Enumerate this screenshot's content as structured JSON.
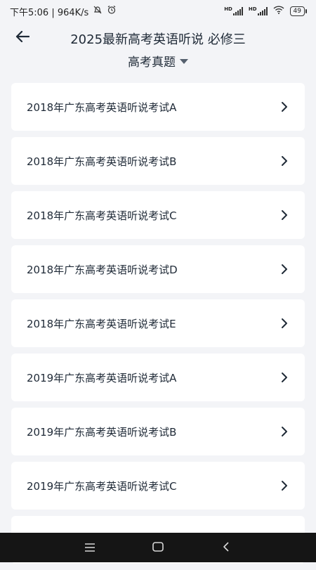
{
  "status_bar": {
    "time_speed": "下午5:06 | 964K/s",
    "hd1": "HD",
    "hd2": "HD",
    "battery": "49"
  },
  "header": {
    "title": "2025最新高考英语听说 必修三",
    "filter_label": "高考真题",
    "back_icon": "arrow-left-icon"
  },
  "list": {
    "items": [
      "2018年广东高考英语听说考试A",
      "2018年广东高考英语听说考试B",
      "2018年广东高考英语听说考试C",
      "2018年广东高考英语听说考试D",
      "2018年广东高考英语听说考试E",
      "2019年广东高考英语听说考试A",
      "2019年广东高考英语听说考试B",
      "2019年广东高考英语听说考试C",
      ""
    ]
  },
  "colors": {
    "background": "#f3f4f7",
    "card": "#ffffff",
    "text": "#1f2a37",
    "nav_bar": "#151515"
  }
}
